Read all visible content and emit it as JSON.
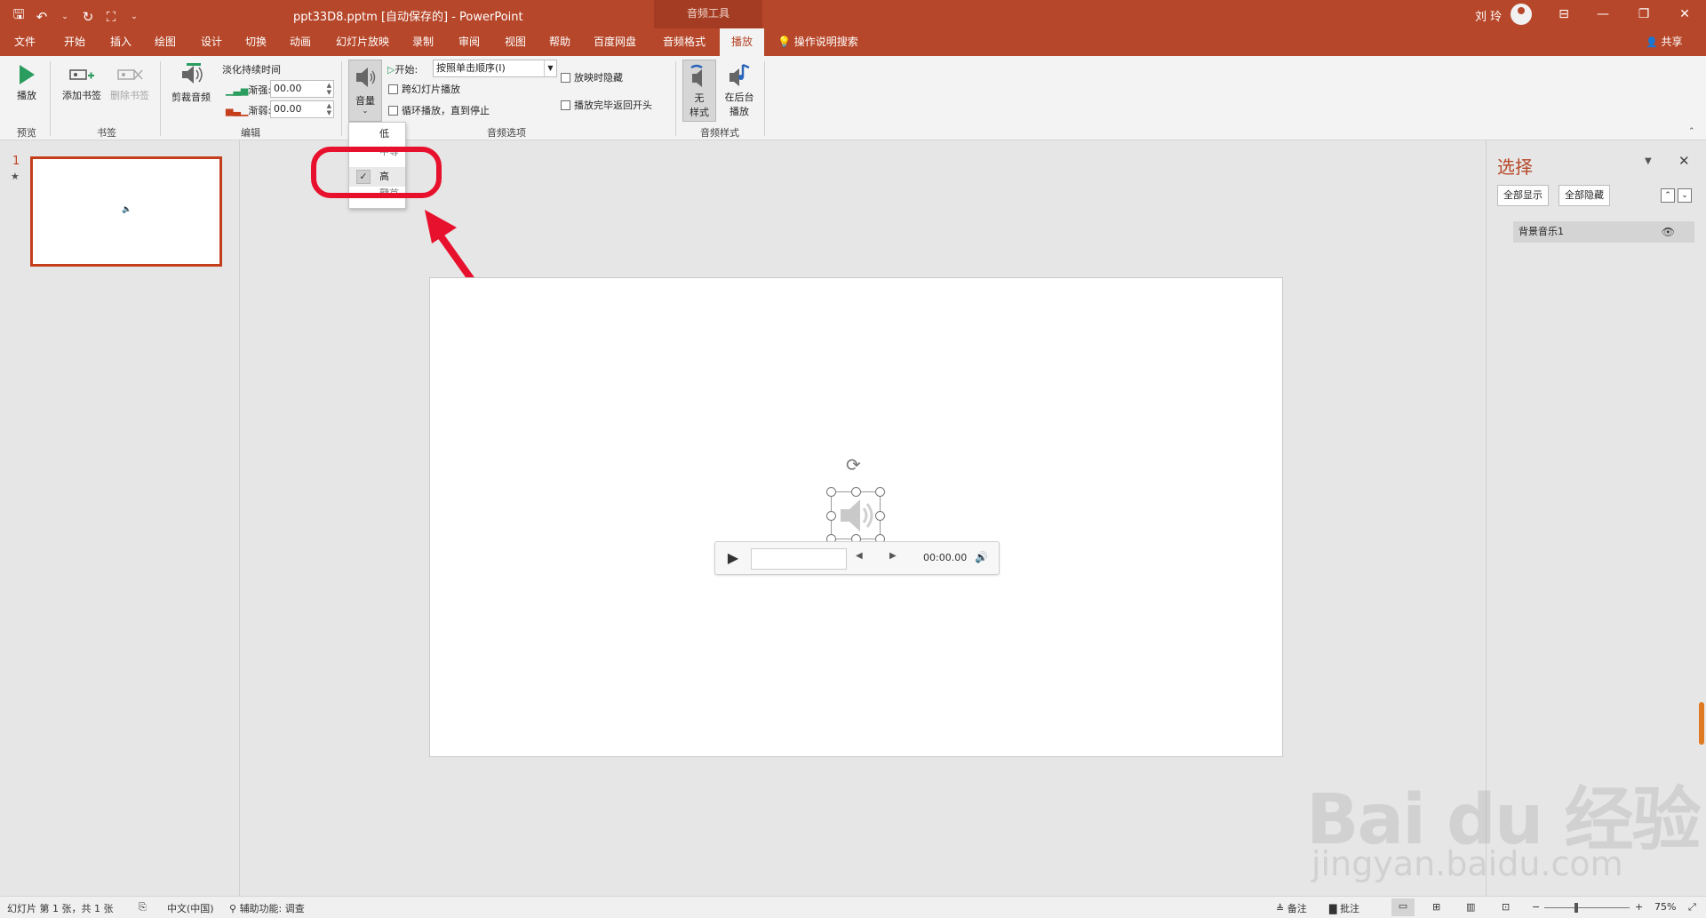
{
  "titlebar": {
    "doc_title": "ppt33D8.pptm [自动保存的] - PowerPoint",
    "context_group": "音频工具",
    "user_name": "刘 玲",
    "qat": {
      "save_icon": "🖫",
      "undo_icon": "↶",
      "undo_drop": "⌄",
      "redo_icon": "↻",
      "present_icon": "⛶",
      "customize_icon": "⌄"
    },
    "window_buttons": {
      "ribbon_display": "⊟",
      "minimize": "—",
      "restore": "❐",
      "close": "✕"
    }
  },
  "tabs": [
    {
      "label": "文件"
    },
    {
      "label": "开始"
    },
    {
      "label": "插入"
    },
    {
      "label": "绘图"
    },
    {
      "label": "设计"
    },
    {
      "label": "切换"
    },
    {
      "label": "动画"
    },
    {
      "label": "幻灯片放映"
    },
    {
      "label": "录制"
    },
    {
      "label": "审阅"
    },
    {
      "label": "视图"
    },
    {
      "label": "帮助"
    },
    {
      "label": "百度网盘"
    },
    {
      "label": "音频格式"
    },
    {
      "label": "播放"
    }
  ],
  "tell_me": "操作说明搜索",
  "tell_me_icon": "💡",
  "share": "共享",
  "share_icon": "👤",
  "ribbon": {
    "preview": {
      "play_label": "播放",
      "group": "预览"
    },
    "bookmarks": {
      "add_label": "添加书签",
      "remove_label": "删除书签",
      "group": "书签"
    },
    "editing": {
      "trim_label": "剪裁音频",
      "fade_title": "淡化持续时间",
      "fade_in_label": "渐强:",
      "fade_in_value": "00.00",
      "fade_out_label": "渐弱:",
      "fade_out_value": "00.00",
      "group": "编辑"
    },
    "audio_options": {
      "volume_label": "音量",
      "start_label": "开始:",
      "start_value": "按照单击顺序(I)",
      "cross_slides": "跨幻灯片播放",
      "loop": "循环播放，直到停止",
      "hide_during_show": "放映时隐藏",
      "rewind": "播放完毕返回开头",
      "group": "音频选项"
    },
    "audio_styles": {
      "no_style_line1": "无",
      "no_style_line2": "样式",
      "background_line1": "在后台",
      "background_line2": "播放",
      "group": "音频样式"
    }
  },
  "volume_menu": {
    "items": [
      {
        "label": "低",
        "checked": false
      },
      {
        "label": "中等",
        "checked": false
      },
      {
        "label": "高",
        "checked": true
      },
      {
        "label": "静音",
        "checked": false
      }
    ],
    "check_glyph": "✓"
  },
  "thumbnails": {
    "number": "1",
    "star": "★",
    "speaker_icon": "🔈"
  },
  "player": {
    "time": "00:00.00",
    "play_icon": "▶",
    "back_icon": "◀",
    "forward_icon": "▶",
    "volume_icon": "🔊",
    "rotate_icon": "⟳"
  },
  "selection_pane": {
    "title": "选择",
    "show_all": "全部显示",
    "hide_all": "全部隐藏",
    "menu_icon": "▼",
    "close_icon": "✕",
    "bring_forward_icon": "⌃",
    "send_backward_icon": "⌄",
    "items": [
      {
        "label": "背景音乐1"
      }
    ],
    "eye_icon": "👁"
  },
  "statusbar": {
    "slide_info": "幻灯片 第 1 张，共 1 张",
    "language": "中文(中国)",
    "accessibility": "辅助功能: 调查",
    "notes": "备注",
    "comments": "批注",
    "zoom_minus": "−",
    "zoom_plus": "+",
    "zoom": "75%"
  },
  "watermark": {
    "main": "Bai du 经验",
    "sub": "jingyan.baidu.com"
  },
  "colors": {
    "accent": "#b7472a",
    "annotation": "#e8112d"
  }
}
